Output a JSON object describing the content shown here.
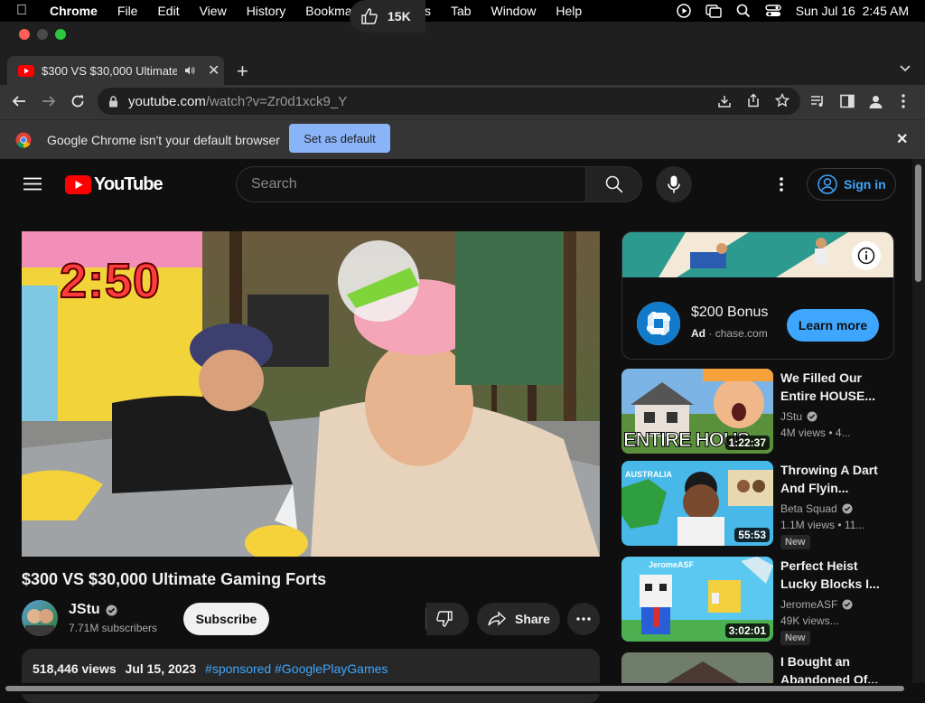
{
  "menubar": {
    "app": "Chrome",
    "items": [
      "File",
      "Edit",
      "View",
      "History",
      "Bookmarks",
      "Profiles",
      "Tab",
      "Window",
      "Help"
    ],
    "datetime": "Sun Jul 16  2:45 AM"
  },
  "tab": {
    "title": "$300 VS $30,000 Ultimate"
  },
  "omnibox": {
    "host": "youtube.com",
    "path": "/watch?v=Zr0d1xck9_Y"
  },
  "infobar": {
    "message": "Google Chrome isn't your default browser",
    "button": "Set as default"
  },
  "youtube": {
    "logo": "YouTube",
    "search_placeholder": "Search",
    "sign_in": "Sign in"
  },
  "video": {
    "overlay_text": "2:50",
    "title": "$300 VS $30,000 Ultimate Gaming Forts",
    "channel": "JStu",
    "subscribers": "7.71M subscribers",
    "subscribe": "Subscribe",
    "likes": "15K",
    "share": "Share",
    "views": "518,446 views",
    "date": "Jul 15, 2023",
    "tags": "#sponsored #GooglePlayGames"
  },
  "ad": {
    "headline": "$200 Bonus",
    "ad_label": "Ad",
    "domain": "chase.com",
    "cta": "Learn more"
  },
  "recommendations": [
    {
      "title": "We Filled Our Entire HOUSE...",
      "channel": "JStu",
      "views": "4M views",
      "age": "• 4...",
      "duration": "1:22:37",
      "thumb_text": "ENTIRE HOUS",
      "badge": ""
    },
    {
      "title": "Throwing A Dart And Flyin...",
      "channel": "Beta Squad",
      "views": "1.1M views",
      "age": "• 11...",
      "duration": "55:53",
      "thumb_text": "AUSTRALIA",
      "badge": "New"
    },
    {
      "title": "Perfect Heist Lucky Blocks I...",
      "channel": "JeromeASF",
      "views": "49K views...",
      "age": "",
      "duration": "3:02:01",
      "thumb_text": "JeromeASF",
      "badge": "New"
    },
    {
      "title": "I Bought an Abandoned Of...",
      "channel": "",
      "views": "",
      "age": "",
      "duration": "",
      "thumb_text": "",
      "badge": ""
    }
  ]
}
